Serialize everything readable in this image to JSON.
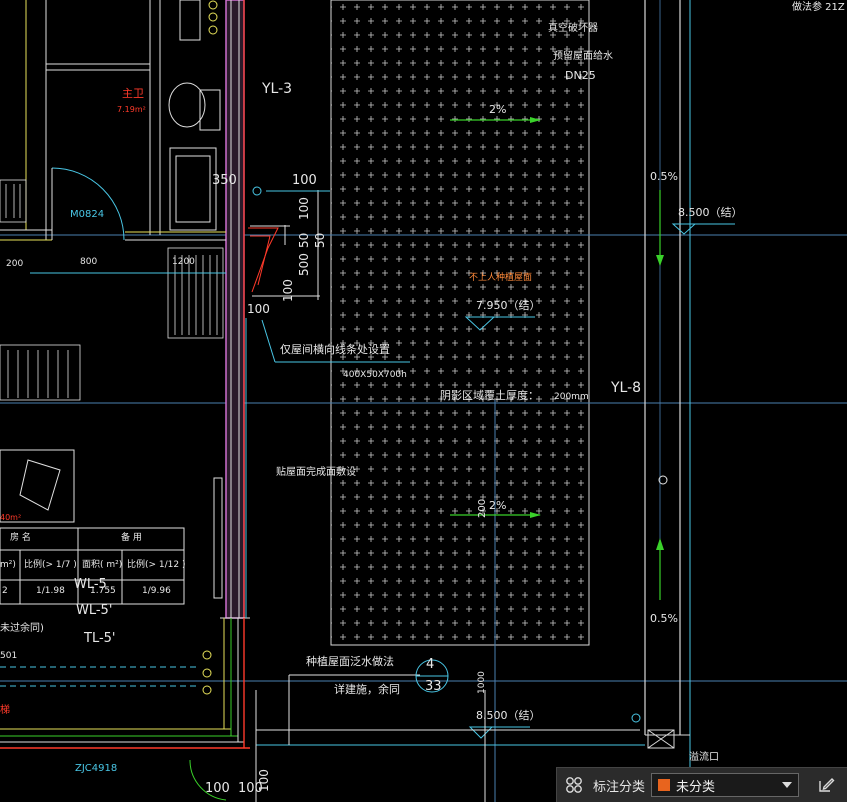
{
  "drawing": {
    "labels": {
      "yl3": "YL-3",
      "yl8": "YL-8",
      "vacuum_breaker": "真空破坏器",
      "reserved_roof_water": "预留屋面给水",
      "dn25": "DN25",
      "slope_top": "2%",
      "slope_mid": "2%",
      "slope_right_top": "0.5%",
      "slope_right_bottom": "0.5%",
      "elev_8500_top": "8.500（结）",
      "elev_7950": "7.950（结）",
      "elev_8500_bottom": "8.500（结）",
      "nonhuman_roof": "不上人种植屋面",
      "dim_350": "350",
      "dim_100_a": "100",
      "dim_100_v": "100",
      "dim_50_a": "50",
      "dim_500": "500",
      "dim_50_b": "50",
      "dim_100_b": "100",
      "dim_100_c": "100",
      "note_beam": "仅屋间横向线条处设置",
      "beam_size": "400X50X700h",
      "shadow_soil": "阴影区域覆土厚度：",
      "soil_200": "200mm",
      "roof_finish": "贴屋面完成面敷设",
      "dim_200_v": "200",
      "planting_roof": "种植屋面泛水做法",
      "detail_ref": "详建施，余同",
      "callout_num": "4",
      "callout_sheet": "33",
      "dim_1000": "1000",
      "overflow": "溢流口",
      "see_text": "做法参 21Z",
      "master_label": "主卫",
      "master_area": "7.19m²",
      "door_m0824": "M0824",
      "dim_200_h": "200",
      "dim_800": "800",
      "dim_1200": "1200",
      "tbl_h1": "房 名",
      "tbl_h2": "备 用",
      "tbl_r1a": "m²)",
      "tbl_r1b": "比例(> 1/7 )",
      "tbl_r1c": "面积( m²)",
      "tbl_r1d": "比例(> 1/12 )",
      "tbl_r2a": "2",
      "tbl_r2b": "1/1.98",
      "tbl_r2c": "1.755",
      "tbl_r2d": "1/9.96",
      "wl5a": "WL-5",
      "wl5b": "WL-5'",
      "tl5": "TL-5'",
      "not_included": "未过余同)",
      "dim_501": "501",
      "zjc": "ZJC4918",
      "dim_100_d": "100",
      "dim_100_e": "100",
      "dim_100_f": "100",
      "room_40": "40m²",
      "stair": "梯"
    }
  },
  "toolbar": {
    "label": "标注分类",
    "selected": "未分类",
    "selected_color": "#e8641e"
  },
  "colors": {
    "background": "#000000",
    "wall": "#d9d9d9",
    "pink_wall": "#d070d0",
    "red": "#ff3a2a",
    "cyan": "#49c6e5",
    "yellow": "#e8e25a",
    "green": "#3ad12a",
    "grid": "#4a7fb0"
  }
}
